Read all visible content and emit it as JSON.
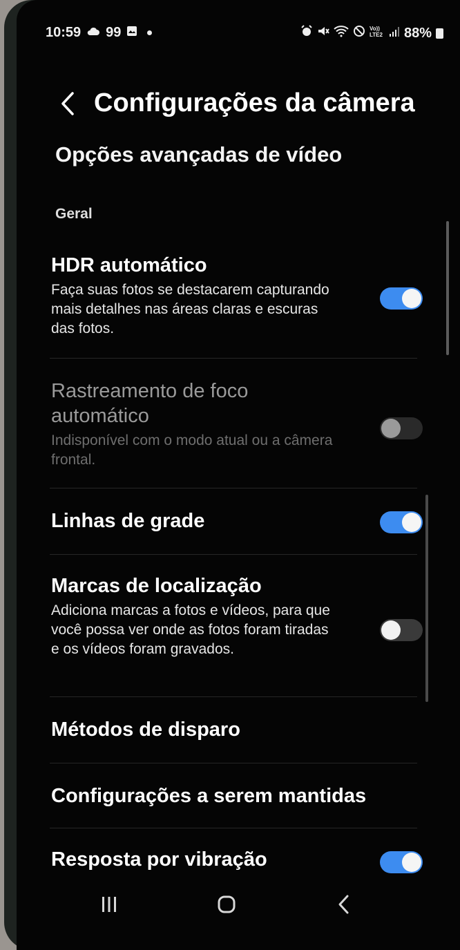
{
  "status_bar": {
    "time": "10:59",
    "notification_count": "99",
    "battery": "88%",
    "icons": [
      "cloud-icon",
      "image-icon",
      "alarm-icon",
      "mute-icon",
      "wifi-icon",
      "do-not-disturb-icon",
      "volte-icon",
      "signal-icon",
      "battery-icon"
    ]
  },
  "header": {
    "title": "Configurações da câmera",
    "back_icon": "chevron-left-icon"
  },
  "link_advanced_video": "Opções avançadas de vídeo",
  "section_general": "Geral",
  "settings": {
    "hdr": {
      "title": "HDR automático",
      "description": "Faça suas fotos se destacarem capturando mais detalhes nas áreas claras e escuras das fotos.",
      "enabled": true
    },
    "focus_tracking": {
      "title": "Rastreamento de foco automático",
      "description": "Indisponível com o modo atual ou a câmera frontal.",
      "enabled": false,
      "available": false
    },
    "grid_lines": {
      "title": "Linhas de grade",
      "enabled": true
    },
    "location_tags": {
      "title": "Marcas de localização",
      "description": "Adiciona marcas a fotos e vídeos, para que você possa ver onde as fotos foram tiradas e os vídeos foram gravados.",
      "enabled": false
    },
    "shooting_methods": {
      "title": "Métodos de disparo"
    },
    "settings_to_keep": {
      "title": "Configurações a serem mantidas"
    },
    "vibration_feedback": {
      "title": "Resposta por vibração",
      "enabled": true
    }
  },
  "colors": {
    "accent": "#3d8cf0",
    "background": "#050505",
    "text": "#ffffff"
  },
  "navigation_bar": {
    "buttons": [
      "recent-apps-icon",
      "home-icon",
      "back-icon"
    ]
  }
}
